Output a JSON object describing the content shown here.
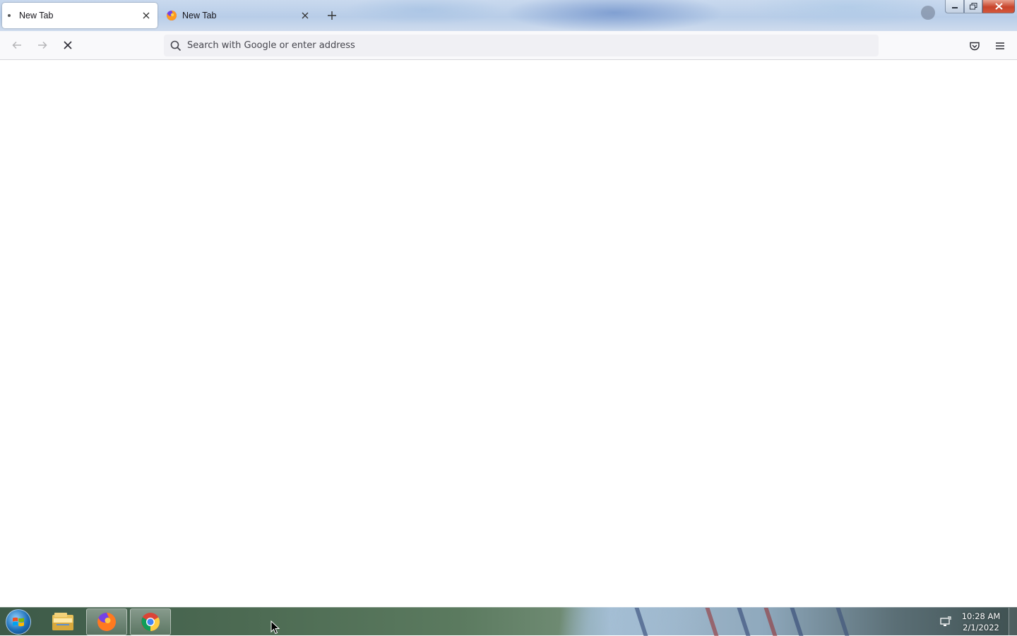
{
  "browser": {
    "tabs": [
      {
        "label": "New Tab",
        "active": true,
        "loading": true
      },
      {
        "label": "New Tab",
        "active": false
      }
    ],
    "address_bar": {
      "placeholder": "Search with Google or enter address",
      "value": ""
    },
    "icons": {
      "back": "arrow-left-icon",
      "forward": "arrow-right-icon",
      "stop": "stop-x-icon",
      "search": "magnifier-icon",
      "pocket": "pocket-icon",
      "menu": "hamburger-icon",
      "new_tab": "plus-icon",
      "tab_close": "close-icon"
    }
  },
  "window_controls": {
    "minimize": "minimize",
    "maximize": "restore",
    "close": "close"
  },
  "taskbar": {
    "apps": [
      "Windows Explorer",
      "Firefox",
      "Google Chrome"
    ],
    "clock": {
      "time": "10:28 AM",
      "date": "2/1/2022"
    }
  },
  "colors": {
    "accent": "#0060df",
    "close_red": "#c8452c",
    "nav_bg": "#f9f9fb",
    "urlbar_bg": "#f0f0f4"
  }
}
